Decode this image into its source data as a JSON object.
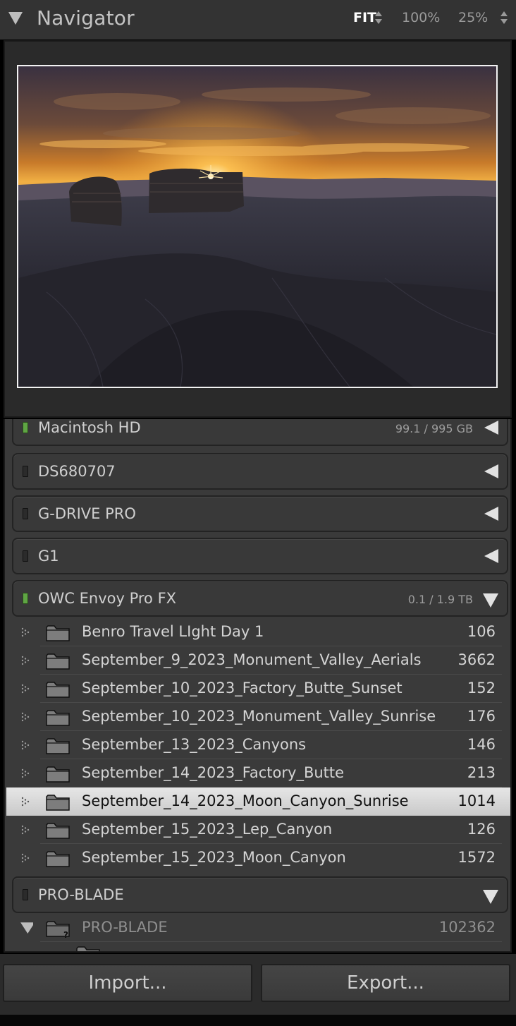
{
  "navigator": {
    "title": "Navigator",
    "zoom_options": {
      "fit": "FIT",
      "z100": "100%",
      "z25": "25%"
    },
    "selected_zoom": "FIT"
  },
  "volumes": [
    {
      "name": "Macintosh HD",
      "size": "99.1 / 995 GB",
      "status": "on",
      "state": "collapsed"
    },
    {
      "name": "DS680707",
      "size": "",
      "status": "off",
      "state": "collapsed"
    },
    {
      "name": "G-DRIVE PRO",
      "size": "",
      "status": "off",
      "state": "collapsed"
    },
    {
      "name": "G1",
      "size": "",
      "status": "off",
      "state": "collapsed"
    },
    {
      "name": "OWC Envoy Pro FX",
      "size": "0.1 / 1.9 TB",
      "status": "on",
      "state": "expanded"
    },
    {
      "name": "PRO-BLADE",
      "size": "",
      "status": "off",
      "state": "expanded"
    }
  ],
  "owc_folders": [
    {
      "name": "Benro Travel LIght Day 1",
      "count": "106"
    },
    {
      "name": "September_9_2023_Monument_Valley_Aerials",
      "count": "3662"
    },
    {
      "name": "September_10_2023_Factory_Butte_Sunset",
      "count": "152"
    },
    {
      "name": "September_10_2023_Monument_Valley_Sunrise",
      "count": "176"
    },
    {
      "name": "September_13_2023_Canyons",
      "count": "146"
    },
    {
      "name": "September_14_2023_Factory_Butte",
      "count": "213"
    },
    {
      "name": "September_14_2023_Moon_Canyon_Sunrise",
      "count": "1014",
      "selected": true
    },
    {
      "name": "September_15_2023_Lep_Canyon",
      "count": "126"
    },
    {
      "name": "September_15_2023_Moon_Canyon",
      "count": "1572"
    }
  ],
  "pro_blade_root": {
    "name": "PRO-BLADE",
    "count": "102362",
    "icon": "missing-folder-icon"
  },
  "buttons": {
    "import": "Import...",
    "export": "Export..."
  },
  "colors": {
    "panel_bg": "#3a3a3a",
    "header_bg": "#333333",
    "online_led": "#5fa544",
    "selected_row": "#d9d9d9",
    "preview_border": "#f2f2f2"
  }
}
